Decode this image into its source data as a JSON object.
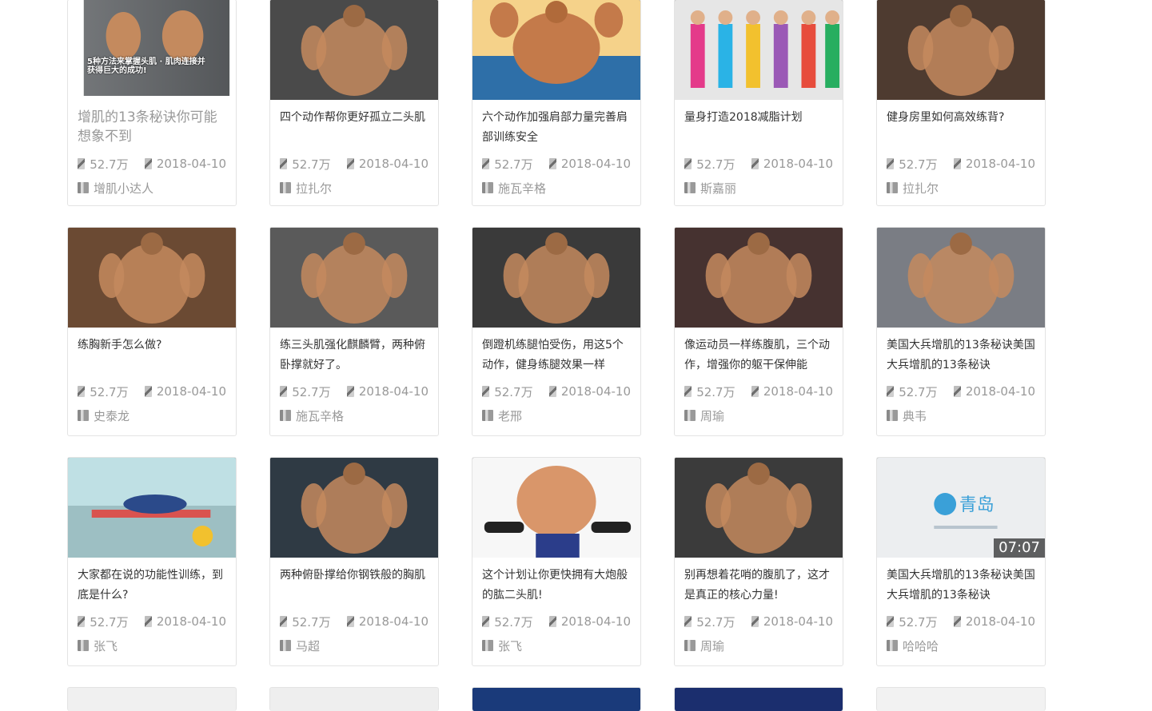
{
  "cards": [
    {
      "title": "增肌的13条秘诀你可能想象不到",
      "views": "52.7万",
      "date": "2018-04-10",
      "author": "增肌小达人",
      "thumb_text": "5种方法来掌握头肌 · 肌肉连接并获得巨大的成功!",
      "bg": "#6a6e72"
    },
    {
      "title": "四个动作帮你更好孤立二头肌",
      "views": "52.7万",
      "date": "2018-04-10",
      "author": "拉扎尔",
      "bg": "#4a4a4a"
    },
    {
      "title": "六个动作加强肩部力量完善肩部训练安全",
      "views": "52.7万",
      "date": "2018-04-10",
      "author": "施瓦辛格",
      "bg": "#3d7fb5"
    },
    {
      "title": "量身打造2018减脂计划",
      "views": "52.7万",
      "date": "2018-04-10",
      "author": "斯嘉丽",
      "bg": "#c9c9c9"
    },
    {
      "title": "健身房里如何高效练背?",
      "views": "52.7万",
      "date": "2018-04-10",
      "author": "拉扎尔",
      "bg": "#4e3b30"
    },
    {
      "title": "练胸新手怎么做?",
      "views": "52.7万",
      "date": "2018-04-10",
      "author": "史泰龙",
      "bg": "#6b4a33"
    },
    {
      "title": "练三头肌强化麒麟臂，两种俯卧撑就好了。",
      "views": "52.7万",
      "date": "2018-04-10",
      "author": "施瓦辛格",
      "bg": "#5a5a5a"
    },
    {
      "title": "倒蹬机练腿怕受伤，用这5个动作，健身练腿效果一样",
      "views": "52.7万",
      "date": "2018-04-10",
      "author": "老邢",
      "bg": "#3a3a3a"
    },
    {
      "title": "像运动员一样练腹肌，三个动作，增强你的躯干保伸能",
      "views": "52.7万",
      "date": "2018-04-10",
      "author": "周瑜",
      "bg": "#463230"
    },
    {
      "title": "美国大兵增肌的13条秘诀美国大兵增肌的13条秘诀",
      "views": "52.7万",
      "date": "2018-04-10",
      "author": "典韦",
      "bg": "#7a7d84"
    },
    {
      "title": "大家都在说的功能性训练，到底是什么?",
      "views": "52.7万",
      "date": "2018-04-10",
      "author": "张飞",
      "bg": "#b9d6d8"
    },
    {
      "title": "两种俯卧撑给你钢铁般的胸肌",
      "views": "52.7万",
      "date": "2018-04-10",
      "author": "马超",
      "bg": "#2f3a44"
    },
    {
      "title": "这个计划让你更快拥有大炮般的肱二头肌!",
      "views": "52.7万",
      "date": "2018-04-10",
      "author": "张飞",
      "bg": "#f4f4f4"
    },
    {
      "title": "别再想着花哨的腹肌了，这才是真正的核心力量!",
      "views": "52.7万",
      "date": "2018-04-10",
      "author": "周瑜",
      "bg": "#3b3b3b"
    },
    {
      "title": "美国大兵增肌的13条秘诀美国大兵增肌的13条秘诀",
      "views": "52.7万",
      "date": "2018-04-10",
      "author": "哈哈哈",
      "bg": "#e9eaec",
      "duration": "07:07",
      "logo_text": "青岛"
    }
  ],
  "partial_row_bg": [
    "#f0f0f0",
    "#eeeeee",
    "#1a3a7a",
    "#1b2e6e",
    "#f2f2f2"
  ]
}
